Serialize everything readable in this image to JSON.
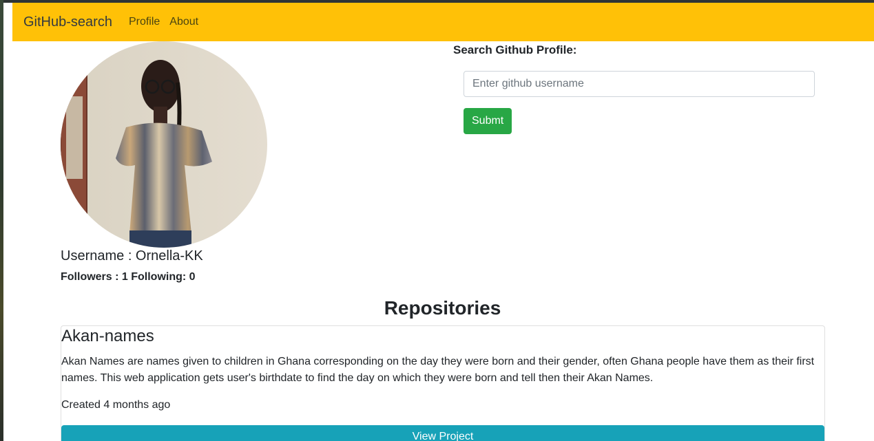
{
  "navbar": {
    "brand": "GitHub-search",
    "links": [
      "Profile",
      "About"
    ],
    "color": "#ffc107"
  },
  "profile": {
    "username_text": "Username : Ornella-KK",
    "follow_text": "Followers : 1 Following: 0"
  },
  "search": {
    "label": "Search Github Profile:",
    "placeholder": "Enter github username",
    "value": "",
    "submit_label": "Submt",
    "submit_color": "#28a745"
  },
  "repos": {
    "heading": "Repositories",
    "items": [
      {
        "name": "Akan-names",
        "description": "Akan Names are names given to children in Ghana corresponding on the day they were born and their gender, often Ghana people have them as their first names. This web application gets user's birthdate to find the day on which they were born and tell then their Akan Names.",
        "created": "Created 4 months ago",
        "button_label": "View Project",
        "button_color": "#17a2b8"
      }
    ]
  }
}
